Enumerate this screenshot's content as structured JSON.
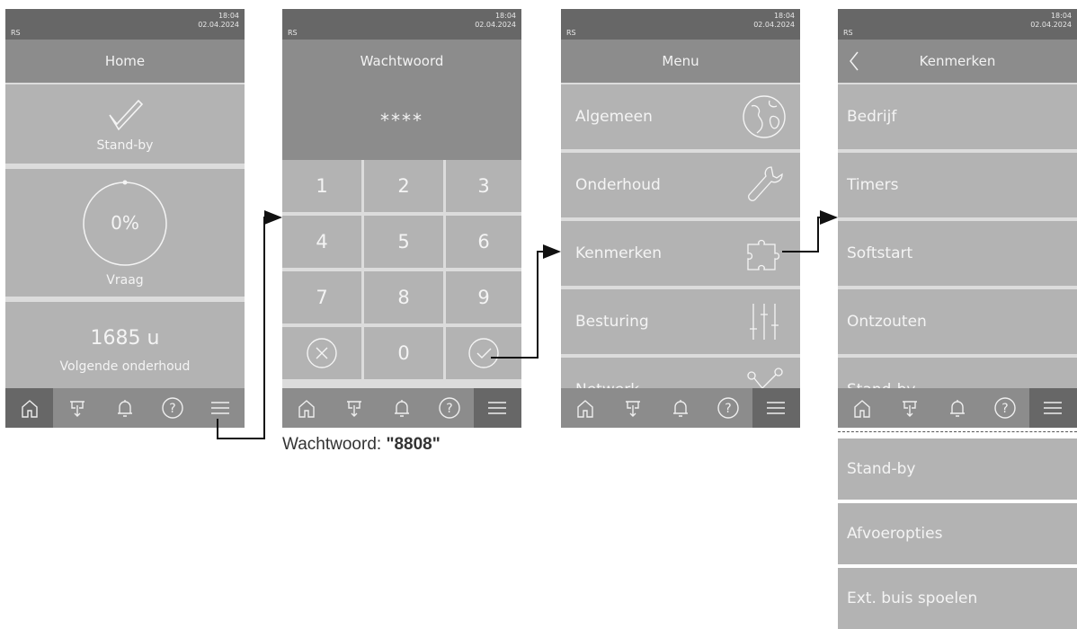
{
  "status": {
    "rs": "RS",
    "time": "18:04",
    "date": "02.04.2024"
  },
  "screen1": {
    "title": "Home",
    "state": "Stand-by",
    "gauge_value": "0%",
    "gauge_label": "Vraag",
    "hours_value": "1685 u",
    "hours_label": "Volgende onderhoud"
  },
  "screen2": {
    "title": "Wachtwoord",
    "masked": "****",
    "keys": [
      "1",
      "2",
      "3",
      "4",
      "5",
      "6",
      "7",
      "8",
      "9",
      "0"
    ]
  },
  "screen3": {
    "title": "Menu",
    "items": [
      {
        "label": "Algemeen",
        "icon": "globe-icon"
      },
      {
        "label": "Onderhoud",
        "icon": "wrench-icon"
      },
      {
        "label": "Kenmerken",
        "icon": "puzzle-icon"
      },
      {
        "label": "Besturing",
        "icon": "sliders-icon"
      },
      {
        "label": "Netwerk",
        "icon": "network-icon"
      }
    ]
  },
  "screen4": {
    "title": "Kenmerken",
    "items": [
      "Bedrijf",
      "Timers",
      "Softstart",
      "Ontzouten",
      "Stand-by"
    ]
  },
  "extension": {
    "items": [
      "Stand-by",
      "Afvoeropties",
      "Ext. buis spoelen"
    ]
  },
  "caption": {
    "prefix": "Wachtwoord: ",
    "value": "\"8808\""
  },
  "bottom_nav": [
    "home-icon",
    "drain-icon",
    "bell-icon",
    "help-icon",
    "menu-icon"
  ],
  "colors": {
    "screen_bg": "#dcdcdc",
    "panel": "#b3b3b3",
    "title": "#8c8c8c",
    "status": "#676767",
    "arrow": "#111111"
  }
}
